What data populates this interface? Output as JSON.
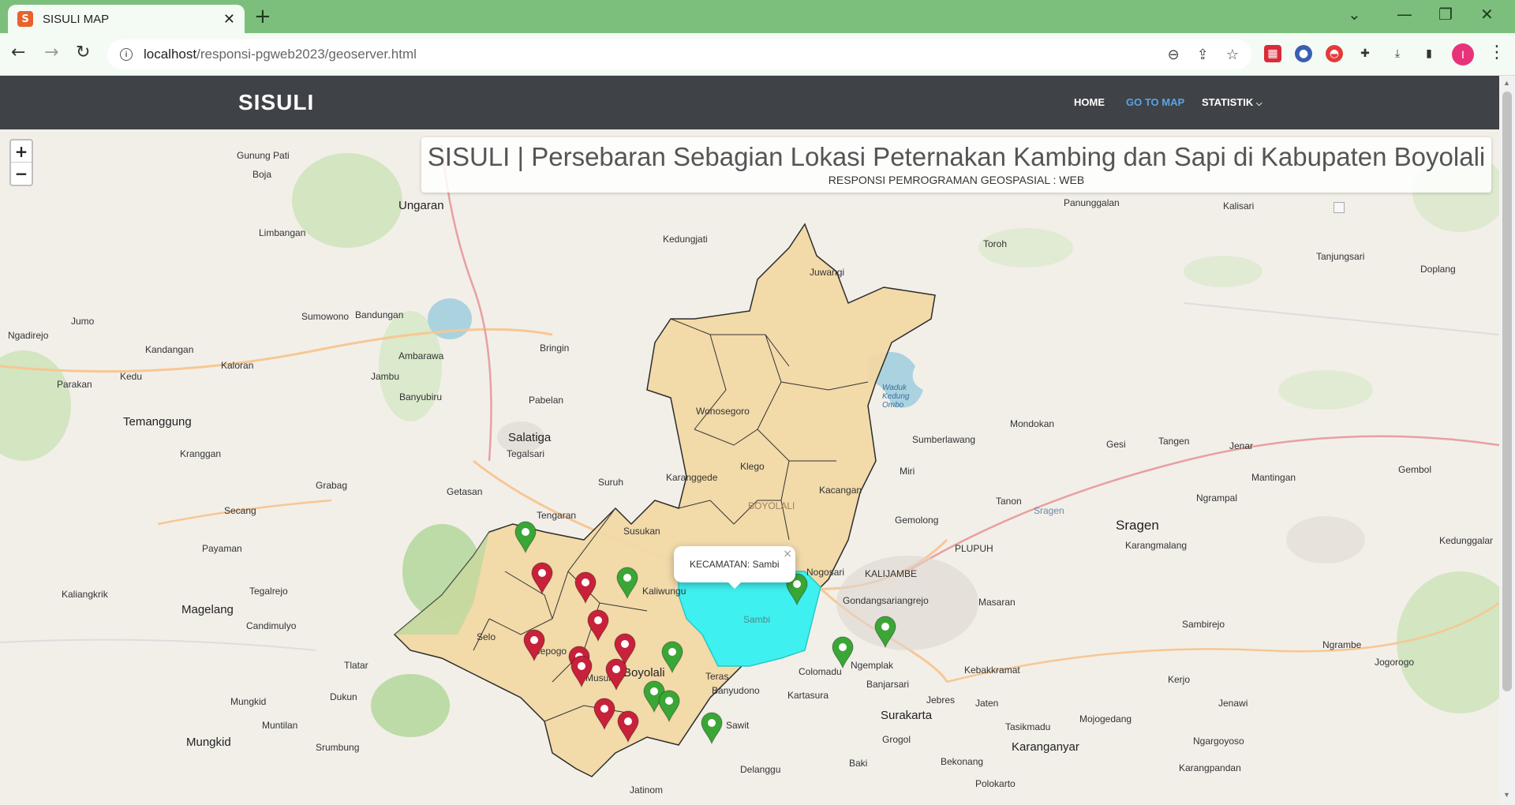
{
  "browser": {
    "tab_title": "SISULI MAP",
    "tab_favicon": "S",
    "url_host": "localhost",
    "url_path": "/responsi-pgweb2023/geoserver.html",
    "profile_initial": "I"
  },
  "site": {
    "brand": "SISULI",
    "menu": {
      "home": "HOME",
      "go_to_map": "GO TO MAP",
      "statistik": "STATISTIK"
    }
  },
  "map": {
    "zoom_in": "+",
    "zoom_out": "−",
    "title": "SISULI | Persebaran Sebagian Lokasi Peternakan Kambing dan Sapi di Kabupaten Boyolali",
    "subtitle": "RESPONSI PEMROGRAMAN GEOSPASIAL : WEB",
    "popup_text": "KECAMATAN: Sambi",
    "popup_close": "×",
    "selected_color": "#3ff0f0",
    "district_fill": "#f3d9a6",
    "goat_marker_color": "#c8213a",
    "cattle_marker_color": "#3aa636",
    "places": {
      "gunung_pati": "Gunung Pati",
      "boja": "Boja",
      "ungaran": "Ungaran",
      "limbangan": "Limbangan",
      "jumo": "Jumo",
      "ngadirejo": "Ngadirejo",
      "sumowono": "Sumowono",
      "bandungan": "Bandungan",
      "kandangan": "Kandangan",
      "kaloran": "Kaloran",
      "ambarawa": "Ambarawa",
      "jambu": "Jambu",
      "parakan": "Parakan",
      "kedu": "Kedu",
      "banyubiru": "Banyubiru",
      "temanggung": "Temanggung",
      "kranggan": "Kranggan",
      "grabag": "Grabag",
      "secang": "Secang",
      "payaman": "Payaman",
      "tegalrejo": "Tegalrejo",
      "kaliangkrik": "Kaliangkrik",
      "magelang": "Magelang",
      "candimulyo": "Candimulyo",
      "tlatar": "Tlatar",
      "mungkid": "Mungkid",
      "muntilan": "Muntilan",
      "dukun": "Dukun",
      "srumbung": "Srumbung",
      "mungkid2": "Mungkid",
      "kedungjati": "Kedungjati",
      "bringin": "Bringin",
      "pabelan": "Pabelan",
      "salatiga": "Salatiga",
      "tegalsari": "Tegalsari",
      "getasan": "Getasan",
      "suruh": "Suruh",
      "tengaran": "Tengaran",
      "susukan": "Susukan",
      "kaliwungu": "Kaliwungu",
      "selo": "Selo",
      "cepogo": "Cepogo",
      "musuk": "Musuk",
      "boyolali": "Boyolali",
      "teras": "Teras",
      "banyudono": "Banyudono",
      "sawit": "Sawit",
      "colomadu": "Colomadu",
      "kartasura": "Kartasura",
      "ngemplak": "Ngemplak",
      "banjarsari": "Banjarsari",
      "surakarta": "Surakarta",
      "jebres": "Jebres",
      "grogol": "Grogol",
      "baki": "Baki",
      "delanggu": "Delanggu",
      "jatinom": "Jatinom",
      "boyolali2": "BOYOLALI",
      "juwangi": "Juwangi",
      "wonosegoro": "Wonosegoro",
      "karanggede": "Karanggede",
      "klego": "Klego",
      "kacangan": "Kacangan",
      "sambi": "Sambi",
      "nogosari": "Nogosari",
      "gondangrejo": "Gondangsariangrejo",
      "kalijambe": "KALIJAMBE",
      "plupuh": "PLUPUH",
      "masaran": "Masaran",
      "sragen": "Sragen",
      "sragen2": "Sragen",
      "karangmalang": "Karangmalang",
      "sambirejo": "Sambirejo",
      "ngrampal": "Ngrampal",
      "kerjo": "Kerjo",
      "jenawi": "Jenawi",
      "ngrambe": "Ngrambe",
      "jogorogo": "Jogorogo",
      "mojogedang": "Mojogedang",
      "karanganyar": "Karanganyar",
      "tasikmadu": "Tasikmadu",
      "jaten": "Jaten",
      "kebakkramat": "Kebakkramat",
      "bekonang": "Bekonang",
      "polokarto": "Polokarto",
      "ngargoyoso": "Ngargoyoso",
      "karangpandan": "Karangpandan",
      "gemolong": "Gemolong",
      "tanon": "Tanon",
      "miri": "Miri",
      "sumberlawang": "Sumberlawang",
      "mondokan": "Mondokan",
      "gesi": "Gesi",
      "tangen": "Tangen",
      "jenar": "Jenar",
      "gembol": "Gembol",
      "mantingan": "Mantingan",
      "kedunggalar": "Kedunggalar",
      "toroh": "Toroh",
      "panunggalan": "Panunggalan",
      "kalisari": "Kalisari",
      "tanjungsari": "Tanjungsari",
      "doplang": "Doplang",
      "waduk": "Waduk Kedung Ombo"
    }
  }
}
